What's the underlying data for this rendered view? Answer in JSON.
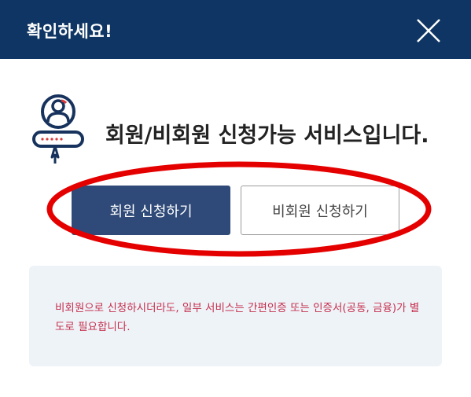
{
  "dialog": {
    "title": "확인하세요!",
    "close_icon": "close-icon"
  },
  "intro": {
    "icon": "user-login-icon",
    "text": "회원/비회원 신청가능 서비스입니다."
  },
  "buttons": {
    "member_label": "회원 신청하기",
    "nonmember_label": "비회원 신청하기"
  },
  "notice": {
    "text": "비회원으로 신청하시더라도, 일부 서비스는 간편인증 또는 인증서(공동, 금융)가 별도로 필요합니다."
  },
  "colors": {
    "header_bg": "#0e3563",
    "member_button_bg": "#2f4a78",
    "notice_text": "#c62e4c",
    "notice_bg": "#eef3f8",
    "annotation": "#e50000"
  }
}
